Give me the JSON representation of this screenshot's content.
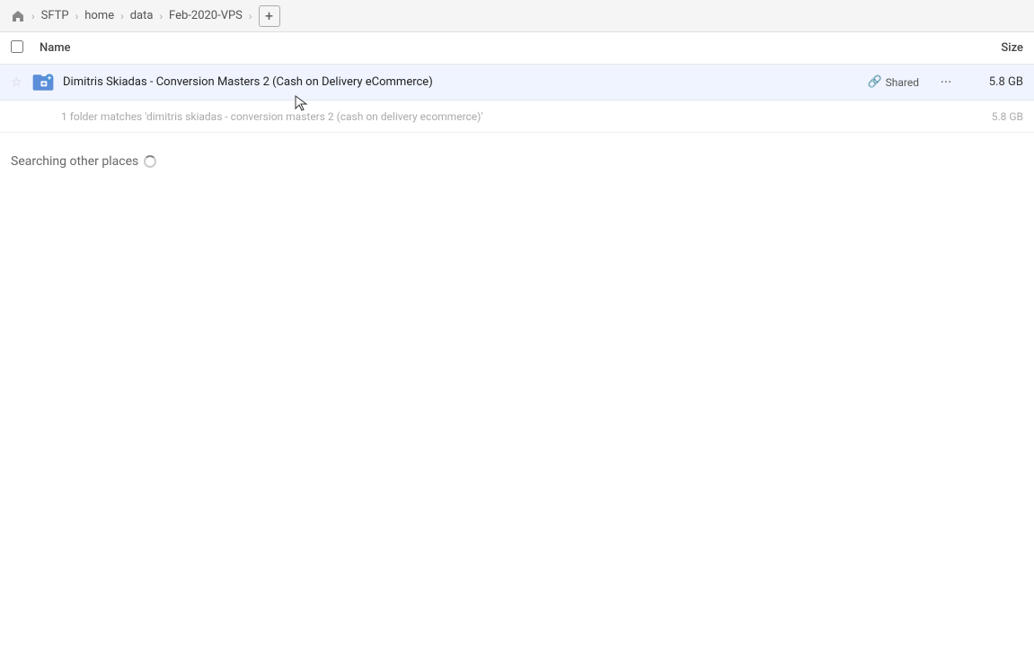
{
  "topbar": {
    "home_icon": "🏠",
    "breadcrumb": [
      {
        "label": "SFTP",
        "id": "sftp"
      },
      {
        "label": "home",
        "id": "home"
      },
      {
        "label": "data",
        "id": "data"
      },
      {
        "label": "Feb-2020-VPS",
        "id": "feb2020vps"
      }
    ],
    "add_tab_label": "+"
  },
  "columns": {
    "name_label": "Name",
    "size_label": "Size"
  },
  "file_row": {
    "name": "Dimitris Skiadas - Conversion Masters 2 (Cash on Delivery eCommerce)",
    "shared_label": "Shared",
    "size": "5.8 GB",
    "more_icon": "···"
  },
  "match_row": {
    "text": "1 folder matches 'dimitris skiadas - conversion masters 2 (cash on delivery ecommerce)'",
    "size": "5.8 GB"
  },
  "searching_section": {
    "title": "Searching other places"
  }
}
